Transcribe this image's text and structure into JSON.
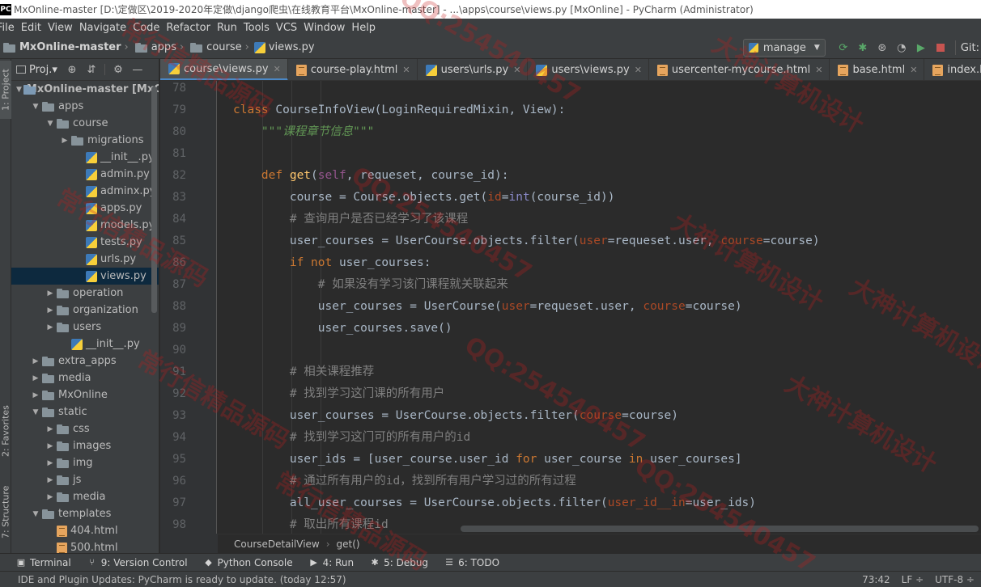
{
  "window": {
    "title": "MxOnline-master [D:\\定做区\\2019-2020年定做\\django爬虫\\在线教育平台\\MxOnline-master] - ...\\apps\\course\\views.py [MxOnline] - PyCharm (Administrator)",
    "app_icon_text": "PC"
  },
  "menu": [
    "File",
    "Edit",
    "View",
    "Navigate",
    "Code",
    "Refactor",
    "Run",
    "Tools",
    "VCS",
    "Window",
    "Help"
  ],
  "navbar": {
    "crumbs": [
      "MxOnline-master",
      "apps",
      "course",
      "views.py"
    ],
    "run_config": "manage",
    "git_label": "Git:"
  },
  "left_strip": {
    "project_tab": "1: Project",
    "favorites_tab": "2: Favorites",
    "structure_tab": "7: Structure"
  },
  "project_panel": {
    "view_label": "Proj.▾",
    "tree": [
      {
        "label": "MxOnline-master [MxOn",
        "depth": 0,
        "type": "project",
        "expanded": true
      },
      {
        "label": "apps",
        "depth": 1,
        "type": "folder",
        "expanded": true
      },
      {
        "label": "course",
        "depth": 2,
        "type": "module",
        "expanded": true
      },
      {
        "label": "migrations",
        "depth": 3,
        "type": "folder",
        "expanded": false
      },
      {
        "label": "__init__.py",
        "depth": 4,
        "type": "py"
      },
      {
        "label": "admin.py",
        "depth": 4,
        "type": "py"
      },
      {
        "label": "adminx.py",
        "depth": 4,
        "type": "py"
      },
      {
        "label": "apps.py",
        "depth": 4,
        "type": "py"
      },
      {
        "label": "models.py",
        "depth": 4,
        "type": "py"
      },
      {
        "label": "tests.py",
        "depth": 4,
        "type": "py"
      },
      {
        "label": "urls.py",
        "depth": 4,
        "type": "py"
      },
      {
        "label": "views.py",
        "depth": 4,
        "type": "py",
        "selected": true
      },
      {
        "label": "operation",
        "depth": 2,
        "type": "module",
        "expanded": false
      },
      {
        "label": "organization",
        "depth": 2,
        "type": "module",
        "expanded": false
      },
      {
        "label": "users",
        "depth": 2,
        "type": "module",
        "expanded": false
      },
      {
        "label": "__init__.py",
        "depth": 3,
        "type": "py"
      },
      {
        "label": "extra_apps",
        "depth": 1,
        "type": "folder",
        "expanded": false
      },
      {
        "label": "media",
        "depth": 1,
        "type": "folder",
        "expanded": false
      },
      {
        "label": "MxOnline",
        "depth": 1,
        "type": "folder",
        "expanded": false
      },
      {
        "label": "static",
        "depth": 1,
        "type": "folder",
        "expanded": true
      },
      {
        "label": "css",
        "depth": 2,
        "type": "folder",
        "expanded": false
      },
      {
        "label": "images",
        "depth": 2,
        "type": "folder",
        "expanded": false
      },
      {
        "label": "img",
        "depth": 2,
        "type": "folder",
        "expanded": false
      },
      {
        "label": "js",
        "depth": 2,
        "type": "folder",
        "expanded": false
      },
      {
        "label": "media",
        "depth": 2,
        "type": "folder",
        "expanded": false
      },
      {
        "label": "templates",
        "depth": 1,
        "type": "folder",
        "expanded": true
      },
      {
        "label": "404.html",
        "depth": 2,
        "type": "html"
      },
      {
        "label": "500.html",
        "depth": 2,
        "type": "html"
      }
    ]
  },
  "editor_tabs": [
    {
      "label": "course\\views.py",
      "type": "py",
      "active": true
    },
    {
      "label": "course-play.html",
      "type": "html"
    },
    {
      "label": "users\\urls.py",
      "type": "py"
    },
    {
      "label": "users\\views.py",
      "type": "py"
    },
    {
      "label": "usercenter-mycourse.html",
      "type": "html"
    },
    {
      "label": "base.html",
      "type": "html"
    },
    {
      "label": "index.html",
      "type": "html"
    }
  ],
  "editor": {
    "first_line": 78,
    "line_numbers": [
      "78",
      "79",
      "80",
      "81",
      "82",
      "83",
      "84",
      "85",
      "86",
      "87",
      "88",
      "89",
      "90",
      "91",
      "92",
      "93",
      "94",
      "95",
      "96",
      "97",
      "98"
    ],
    "lines": [
      [],
      [
        [
          "kw",
          "class "
        ],
        [
          "",
          "CourseInfoView(LoginRequiredMixin, View):"
        ]
      ],
      [
        [
          "ds",
          "    \"\"\"课程章节信息\"\"\""
        ]
      ],
      [],
      [
        [
          "kw",
          "    def "
        ],
        [
          "fn",
          "get"
        ],
        [
          "",
          "("
        ],
        [
          "sf",
          "self"
        ],
        [
          "",
          ", requeset, course_id):"
        ]
      ],
      [
        [
          "",
          "        course = Course.objects.get("
        ],
        [
          "pr",
          "id"
        ],
        [
          "",
          "="
        ],
        [
          "bi",
          "int"
        ],
        [
          "",
          "(course_id))"
        ]
      ],
      [
        [
          "cm",
          "        # 查询用户是否已经学习了该课程"
        ]
      ],
      [
        [
          "",
          "        user_courses = UserCourse.objects.filter("
        ],
        [
          "pr",
          "user"
        ],
        [
          "",
          "=requeset.user, "
        ],
        [
          "pr",
          "course"
        ],
        [
          "",
          "=course)"
        ]
      ],
      [
        [
          "kw",
          "        if not "
        ],
        [
          "",
          "user_courses:"
        ]
      ],
      [
        [
          "cm",
          "            # 如果没有学习该门课程就关联起来"
        ]
      ],
      [
        [
          "",
          "            user_courses = UserCourse("
        ],
        [
          "pr",
          "user"
        ],
        [
          "",
          "=requeset.user, "
        ],
        [
          "pr",
          "course"
        ],
        [
          "",
          "=course)"
        ]
      ],
      [
        [
          "",
          "            user_courses.save()"
        ]
      ],
      [],
      [
        [
          "cm",
          "        # 相关课程推荐"
        ]
      ],
      [
        [
          "cm",
          "        # 找到学习这门课的所有用户"
        ]
      ],
      [
        [
          "",
          "        user_courses = UserCourse.objects.filter("
        ],
        [
          "pr",
          "course"
        ],
        [
          "",
          "=course)"
        ]
      ],
      [
        [
          "cm",
          "        # 找到学习这门可的所有用户的id"
        ]
      ],
      [
        [
          "",
          "        user_ids = [user_course.user_id "
        ],
        [
          "kw",
          "for "
        ],
        [
          "",
          "user_course "
        ],
        [
          "kw",
          "in "
        ],
        [
          "",
          "user_courses]"
        ]
      ],
      [
        [
          "cm",
          "        # 通过所有用户的id，找到所有用户学习过的所有过程"
        ]
      ],
      [
        [
          "",
          "        all_user_courses = UserCourse.objects.filter("
        ],
        [
          "pr",
          "user_id__in"
        ],
        [
          "",
          "=user_ids)"
        ]
      ],
      [
        [
          "cm",
          "        # 取出所有课程id"
        ]
      ]
    ]
  },
  "editor_breadcrumb": [
    "CourseDetailView",
    "get()"
  ],
  "tool_windows": [
    {
      "label": "Terminal",
      "icon": "terminal-icon"
    },
    {
      "label": "9: Version Control",
      "icon": "vcs-icon"
    },
    {
      "label": "Python Console",
      "icon": "python-icon"
    },
    {
      "label": "4: Run",
      "icon": "run-icon"
    },
    {
      "label": "5: Debug",
      "icon": "debug-icon"
    },
    {
      "label": "6: TODO",
      "icon": "todo-icon"
    }
  ],
  "status": {
    "message": "IDE and Plugin Updates: PyCharm is ready to update. (today 12:57)",
    "position": "73:42",
    "line_sep": "LF ÷",
    "encoding": "UTF-8 ÷"
  },
  "watermarks": [
    "常行信精品源码",
    "QQ:254540457",
    "大神计算机设计"
  ],
  "colors": {
    "background": "#2b2b2b",
    "panel": "#3c3f41",
    "keyword": "#cc7832",
    "function": "#ffc66d",
    "comment": "#808080",
    "docstring": "#629755",
    "param": "#aa4926",
    "accent": "#4a88c7"
  }
}
